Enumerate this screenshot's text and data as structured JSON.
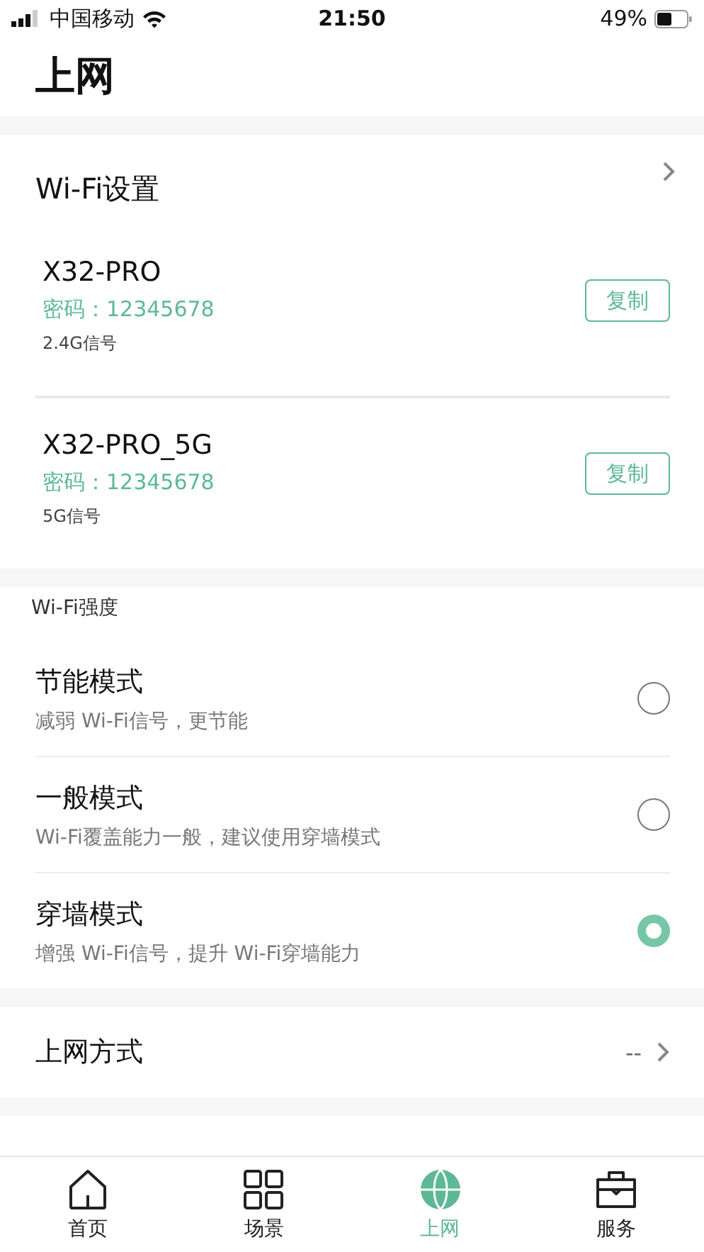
{
  "status_bar": {
    "carrier": "中国移动",
    "time": "21:50",
    "battery": "49%"
  },
  "title": "上网",
  "wifi_settings": {
    "title": "Wi-Fi设置",
    "networks": [
      {
        "name": "X32-PRO",
        "password": "密码：12345678",
        "band": "2.4G信号",
        "button": "复制"
      },
      {
        "name": "X32-PRO_5G",
        "password": "密码：12345678",
        "band": "5G信号",
        "button": "复制"
      }
    ]
  },
  "wifi_strength": {
    "title": "Wi-Fi强度",
    "modes": [
      {
        "name": "节能模式",
        "description": "减弱 Wi-Fi信号，更节能",
        "selected": false
      },
      {
        "name": "一般模式",
        "description": "Wi-Fi覆盖能力一般，建议使用穿墙模式",
        "selected": false
      },
      {
        "name": "穿墙模式",
        "description": "增强 Wi-Fi信号，提升 Wi-Fi穿墙能力",
        "selected": true
      }
    ]
  },
  "connection_method": {
    "label": "上网方式",
    "value": "--"
  },
  "tab_bar": [
    {
      "kind": "home",
      "label": "首页",
      "selected": false
    },
    {
      "kind": "grid",
      "label": "场景",
      "selected": false
    },
    {
      "kind": "globe",
      "label": "上网",
      "selected": true
    },
    {
      "kind": "briefcase",
      "label": "服务",
      "selected": false
    }
  ]
}
